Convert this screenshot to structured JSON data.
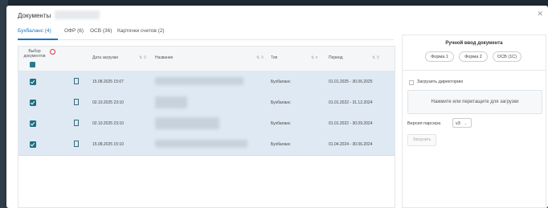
{
  "dialog": {
    "title": "Документы",
    "close_icon": "close-icon"
  },
  "tabs": [
    {
      "label": "Бухбаланс (4)",
      "active": true
    },
    {
      "label": "ОФР (6)"
    },
    {
      "label": "ОСВ (36)"
    },
    {
      "label": "Карточки счетов (2)"
    }
  ],
  "table": {
    "headers": {
      "select": "Выбор документов",
      "date": "Дата загрузки",
      "name": "Название",
      "type": "Тип",
      "period": "Период"
    },
    "rows": [
      {
        "date": "15.08.2025 15:07",
        "type": "Бухбаланс",
        "period": "01.01.2025 - 30.06.2025"
      },
      {
        "date": "02.10.2025 23:10",
        "type": "Бухбаланс",
        "period": "01.01.2022 - 31.12.2024"
      },
      {
        "date": "02.10.2025 23:10",
        "type": "Бухбаланс",
        "period": "01.01.2022 - 30.09.2024"
      },
      {
        "date": "15.08.2025 15:10",
        "type": "Бухбаланс",
        "period": "01.04.2024 - 30.06.2024"
      }
    ]
  },
  "manual_input": {
    "title": "Ручной ввод документа",
    "buttons": [
      "Форма 1",
      "Форма 2",
      "ОСВ (1С)"
    ]
  },
  "upload": {
    "directory_label": "Загрузить директорию",
    "dropzone": "Нажмите или перетащите для загрузки",
    "parser_label": "Версия парсера",
    "parser_value": "v3",
    "submit_label": "Загрузить"
  },
  "colors": {
    "accent": "#1677c5",
    "checkbox": "#1f6e80",
    "row_selected": "#dfe9f3"
  }
}
